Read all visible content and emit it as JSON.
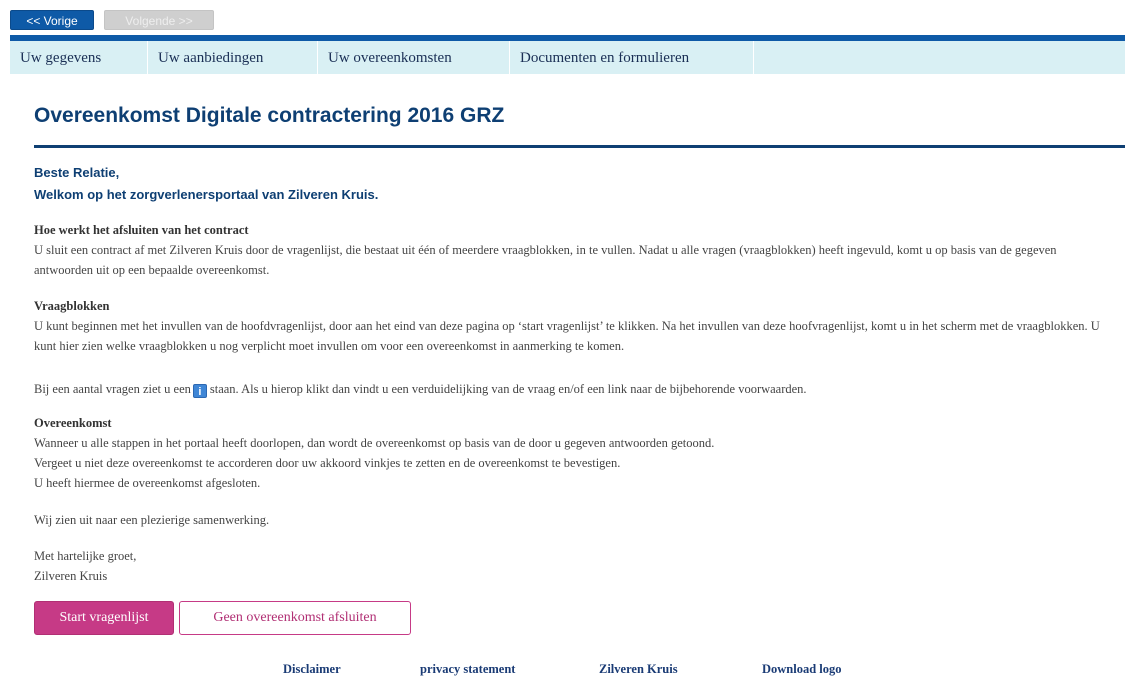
{
  "nav": {
    "prev_label": "<< Vorige",
    "next_label": "Volgende >>"
  },
  "tabs": [
    {
      "label": "Uw gegevens"
    },
    {
      "label": "Uw aanbiedingen"
    },
    {
      "label": "Uw overeenkomsten"
    },
    {
      "label": "Documenten en formulieren"
    }
  ],
  "page": {
    "title": "Overeenkomst Digitale contractering 2016 GRZ"
  },
  "greeting": {
    "line1": "Beste Relatie,",
    "line2": "Welkom op het zorgverlenersportaal van Zilveren Kruis."
  },
  "sections": {
    "contract": {
      "heading": "Hoe werkt het afsluiten van het contract",
      "text": "U sluit een contract af met Zilveren Kruis door de vragenlijst, die bestaat uit één of meerdere vraagblokken, in te vullen. Nadat u alle vragen (vraagblokken) heeft ingevuld, komt u op basis van de gegeven antwoorden uit op een bepaalde overeenkomst."
    },
    "vraagblokken": {
      "heading": "Vraagblokken",
      "text": "U kunt beginnen met het invullen van de hoofdvragenlijst, door aan het eind van deze pagina op ‘start vragenlijst’ te klikken. Na het invullen van deze hoofvragenlijst, komt u in het scherm met de vraagblokken. U kunt hier zien welke vraagblokken u nog verplicht moet invullen om voor een overeenkomst in aanmerking te komen."
    },
    "info": {
      "before_icon": "Bij een aantal vragen ziet u een",
      "after_icon": "staan. Als u hierop klikt dan vindt u een verduidelijking van de vraag en/of een link naar de bijbehorende voorwaarden.",
      "icon_glyph": "i"
    },
    "overeenkomst": {
      "heading": "Overeenkomst",
      "line1": "Wanneer u alle stappen in het portaal heeft doorlopen, dan wordt de overeenkomst op basis van de door u gegeven antwoorden getoond.",
      "line2": "Vergeet u niet deze overeenkomst te accorderen door uw akkoord vinkjes te zetten en de overeenkomst te bevestigen.",
      "line3": "U heeft hiermee de overeenkomst afgesloten."
    },
    "closing": {
      "text": "Wij zien uit naar een plezierige samenwerking.",
      "regards": "Met hartelijke groet,",
      "signature": "Zilveren Kruis"
    }
  },
  "actions": {
    "start_label": "Start vragenlijst",
    "decline_label": "Geen overeenkomst afsluiten"
  },
  "footer": {
    "links": [
      {
        "label": "Disclaimer"
      },
      {
        "label": "privacy statement"
      },
      {
        "label": "Zilveren Kruis"
      },
      {
        "label": "Download logo"
      }
    ]
  },
  "colors": {
    "primary_blue": "#0e5aa7",
    "title_blue": "#0e3f73",
    "tab_background": "#d9f0f4",
    "accent_magenta": "#c63a86"
  },
  "icons": {
    "info": "info-icon"
  }
}
